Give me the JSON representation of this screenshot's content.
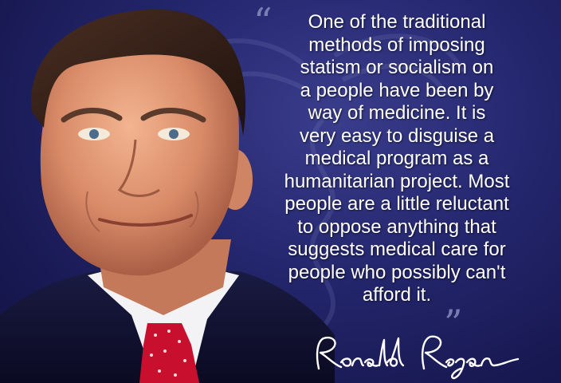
{
  "quote": {
    "text": "One of the traditional\nmethods of imposing\nstatism or socialism on\na people have been by\nway of medicine. It is\nvery easy to disguise a\nmedical program as a\nhumanitarian project. Most\npeople are a little reluctant\nto oppose anything that\nsuggests medical care for\npeople who possibly can't\nafford it.",
    "open_mark": "“",
    "close_mark": "”"
  },
  "signature": {
    "text": "Ronald Reagan"
  },
  "colors": {
    "background": "#25276f",
    "text": "#ffffff",
    "tie": "#c8102e",
    "suit": "#0f1030"
  }
}
